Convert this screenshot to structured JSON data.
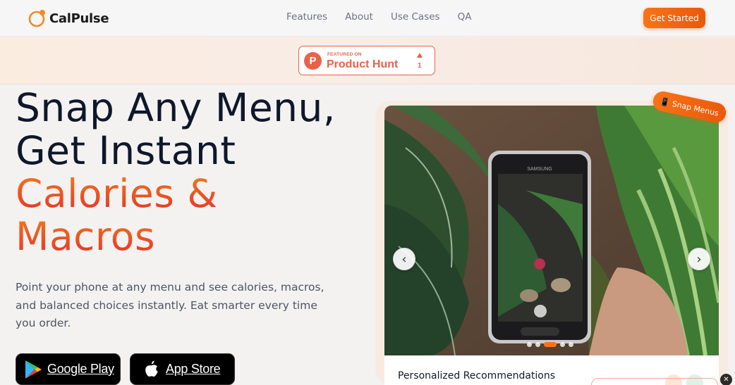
{
  "header": {
    "brand": "CalPulse",
    "nav": [
      "Features",
      "About",
      "Use Cases",
      "QA"
    ],
    "cta_label": "Get Started"
  },
  "product_hunt": {
    "featured_label": "FEATURED ON",
    "name": "Product Hunt",
    "upvotes": "1"
  },
  "hero": {
    "title_line1": "Snap Any Menu,",
    "title_line2": "Get Instant",
    "title_accent1": "Calories &",
    "title_accent2": "Macros",
    "subtitle": "Point your phone at any menu and see calories, macros, and balanced choices instantly. Eat smarter every time you order.",
    "google_play": "Google Play",
    "app_store": "App Store"
  },
  "showcase": {
    "ribbon": "📱 Snap Menus",
    "phone_brand": "SAMSUNG",
    "prev_label": "‹",
    "next_label": "›",
    "slide_count": 5,
    "active_slide": 3,
    "card_title": "Personalized Recommendations"
  },
  "colors": {
    "accent": "#f97316",
    "accent_dark": "#ea580c",
    "ph_red": "#e8624a"
  }
}
